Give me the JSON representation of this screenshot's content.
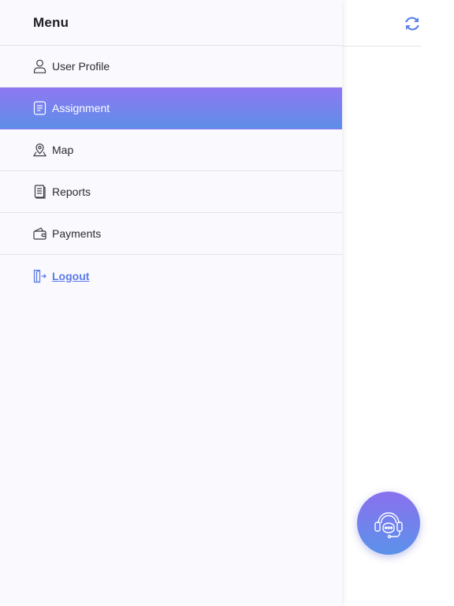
{
  "drawer": {
    "title": "Menu",
    "items": [
      {
        "label": "User Profile",
        "icon": "user-icon",
        "active": false
      },
      {
        "label": "Assignment",
        "icon": "document-icon",
        "active": true
      },
      {
        "label": "Map",
        "icon": "map-pin-icon",
        "active": false
      },
      {
        "label": "Reports",
        "icon": "report-icon",
        "active": false
      },
      {
        "label": "Payments",
        "icon": "wallet-icon",
        "active": false
      }
    ],
    "logout": {
      "label": "Logout",
      "icon": "logout-icon"
    }
  },
  "header": {
    "refresh_icon": "refresh-icon"
  },
  "support": {
    "icon": "support-headset-icon"
  },
  "colors": {
    "accent": "#6f86ec",
    "gradient_start": "#8e78f2",
    "gradient_end": "#5d8ee8",
    "drawer_bg": "#f9f9fe",
    "logout": "#5d7de8"
  }
}
